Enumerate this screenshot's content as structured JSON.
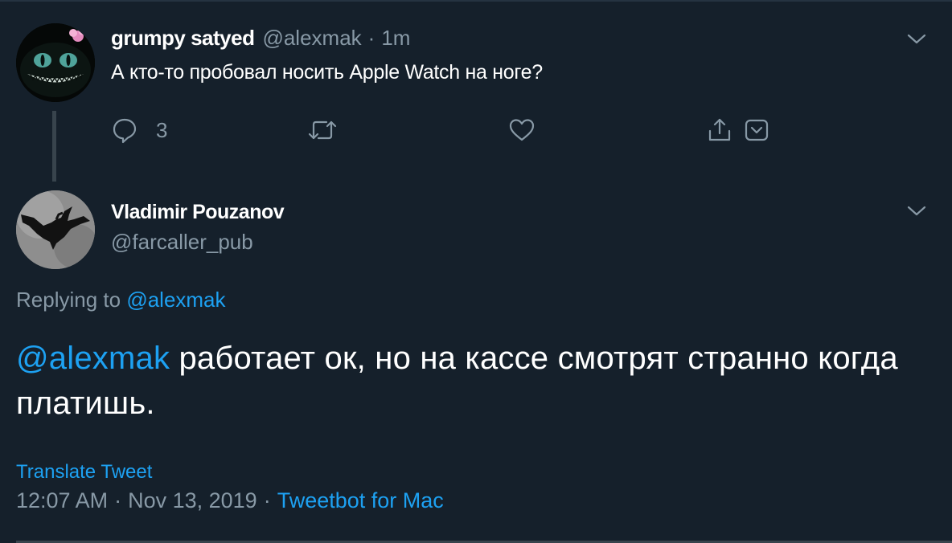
{
  "parent_tweet": {
    "display_name": "grumpy satyed",
    "handle": "@alexmak",
    "separator": "·",
    "time": "1m",
    "text": "А кто-то пробовал носить Apple Watch на ноге?",
    "reply_count": "3",
    "avatar_icon": "cheshire-cat-avatar"
  },
  "tweet": {
    "display_name": "Vladimir Pouzanov",
    "handle": "@farcaller_pub",
    "replying_label": "Replying to",
    "replying_to": "@alexmak",
    "mention": "@alexmak",
    "text": " работает ок, но на кассе смотрят странно когда платишь.",
    "translate_label": "Translate Tweet",
    "time": "12:07 AM",
    "separator": "·",
    "date": "Nov 13, 2019",
    "source": "Tweetbot for Mac",
    "avatar_icon": "crow-avatar"
  },
  "colors": {
    "background": "#15202b",
    "primary_text": "#ffffff",
    "secondary_text": "#8899a6",
    "accent": "#1da1f2",
    "border": "#38444d"
  },
  "icons": {
    "reply": "reply-icon",
    "retweet": "retweet-icon",
    "like": "heart-icon",
    "share": "share-icon",
    "save": "save-icon",
    "more": "chevron-down-icon"
  }
}
